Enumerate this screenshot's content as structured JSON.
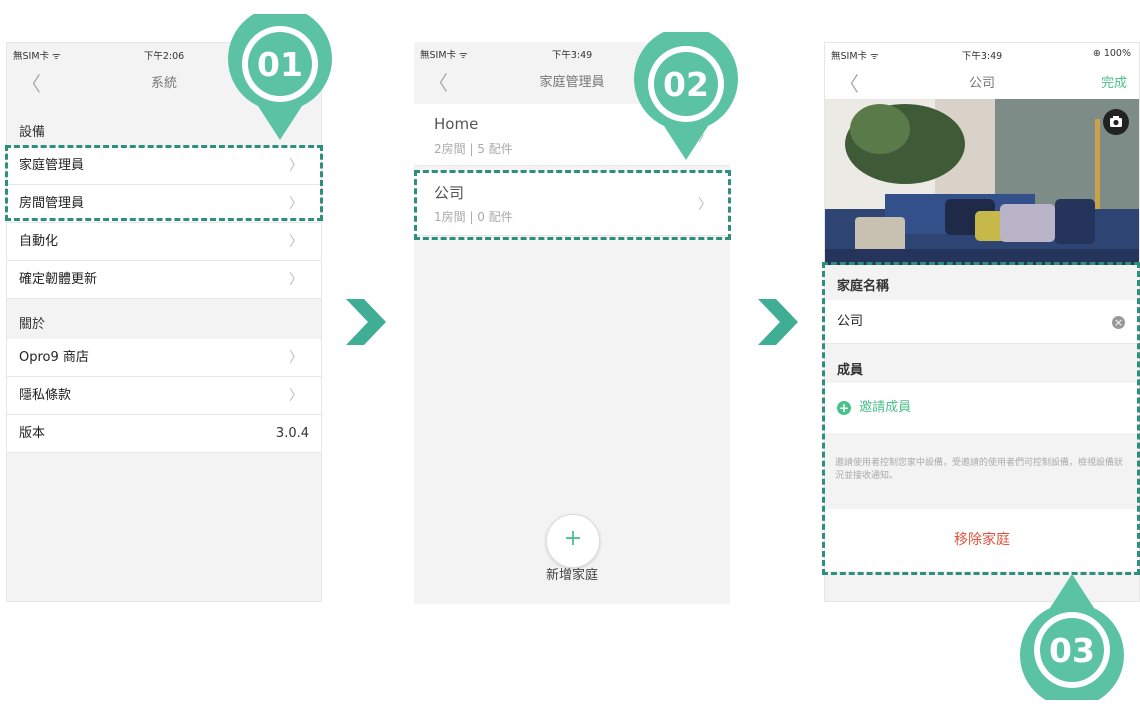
{
  "phone1": {
    "status": {
      "carrier": "無SIM卡 ᯤ",
      "time": "下午2:06"
    },
    "nav": {
      "back": "〈",
      "title": "系統"
    },
    "section_devices": "設備",
    "rows": [
      {
        "label": "家庭管理員",
        "chevron": "〉"
      },
      {
        "label": "房間管理員",
        "chevron": "〉"
      },
      {
        "label": "自動化",
        "chevron": "〉"
      },
      {
        "label": "確定韌體更新",
        "chevron": "〉"
      }
    ],
    "section_about": "關於",
    "about_rows": [
      {
        "label": "Opro9 商店",
        "chevron": "〉"
      },
      {
        "label": "隱私條款",
        "chevron": "〉"
      },
      {
        "label": "版本",
        "value": "3.0.4"
      }
    ]
  },
  "phone2": {
    "status": {
      "carrier": "無SIM卡 ᯤ",
      "time": "下午3:49"
    },
    "nav": {
      "back": "〈",
      "title": "家庭管理員"
    },
    "homes": [
      {
        "name": "Home",
        "detail": "2房間 | 5 配件",
        "chevron": "〉"
      },
      {
        "name": "公司",
        "detail": "1房間 | 0 配件",
        "chevron": "〉"
      }
    ],
    "add_icon": "+",
    "add_label": "新增家庭"
  },
  "phone3": {
    "status": {
      "carrier": "無SIM卡 ᯤ",
      "time": "下午3:49",
      "battery": "⊕ 100%"
    },
    "nav": {
      "back": "〈",
      "title": "公司",
      "done": "完成"
    },
    "section_name": "家庭名稱",
    "name_value": "公司",
    "clear_icon": "×",
    "section_members": "成員",
    "invite_icon": "+",
    "invite_label": "邀請成員",
    "invite_note": "邀請使用者控制您家中設備，受邀請的使用者們可控制設備，檢視設備狀況並接收通知。",
    "remove_label": "移除家庭"
  },
  "badges": {
    "b1": "01",
    "b2": "02",
    "b3": "03"
  },
  "colors": {
    "accent": "#4cc08a",
    "badge": "#5bc2a4",
    "dash": "#2e8f7d",
    "danger": "#e0533e"
  }
}
